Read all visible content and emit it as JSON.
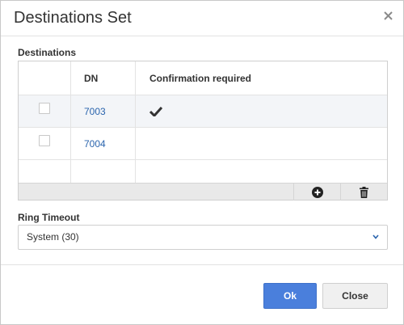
{
  "dialog": {
    "title": "Destinations Set",
    "close_icon": "close-icon"
  },
  "destinations": {
    "label": "Destinations",
    "columns": [
      "",
      "DN",
      "Confirmation required"
    ],
    "rows": [
      {
        "dn": "7003",
        "checked": false,
        "confirmation_required": true
      },
      {
        "dn": "7004",
        "checked": false,
        "confirmation_required": false
      }
    ],
    "toolbar": {
      "add_icon": "plus-circle-icon",
      "delete_icon": "trash-icon"
    }
  },
  "ring_timeout": {
    "label": "Ring Timeout",
    "selected": "System (30)"
  },
  "footer": {
    "ok_label": "Ok",
    "close_label": "Close"
  },
  "colors": {
    "accent": "#4a7fdc",
    "link": "#2a64ad"
  }
}
